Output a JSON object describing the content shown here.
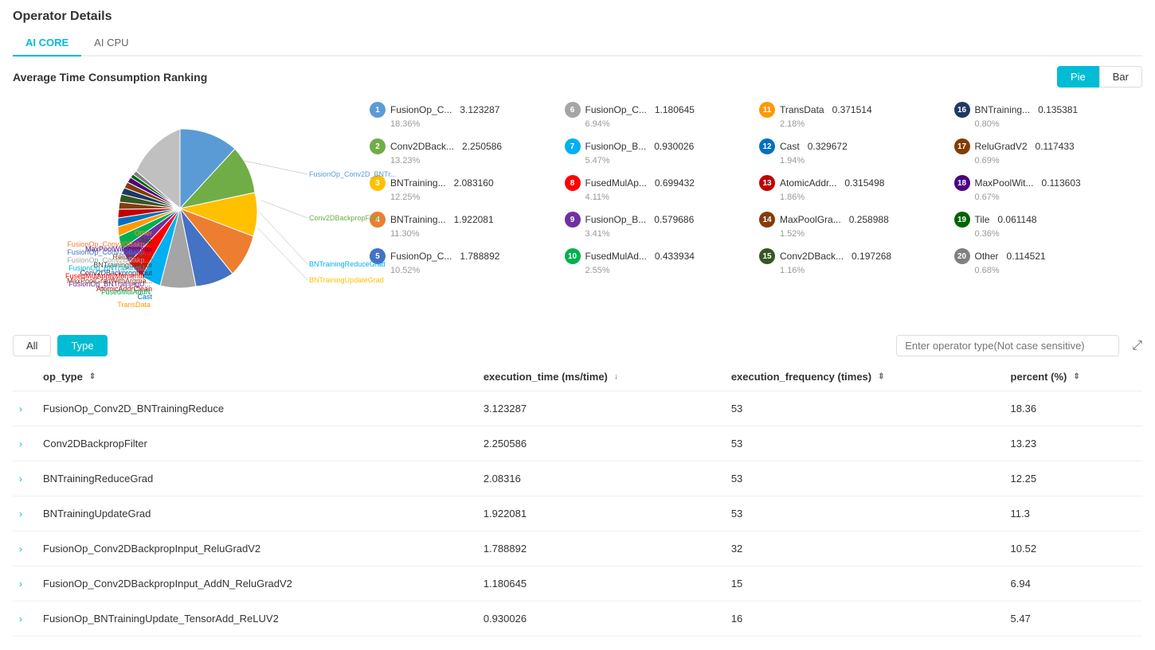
{
  "page": {
    "title": "Operator Details",
    "tabs": [
      {
        "label": "AI CORE",
        "active": true
      },
      {
        "label": "AI CPU",
        "active": false
      }
    ]
  },
  "section": {
    "title": "Average Time Consumption Ranking",
    "toggle_buttons": [
      {
        "label": "Pie",
        "active": true
      },
      {
        "label": "Bar",
        "active": false
      }
    ]
  },
  "pie_labels": [
    "Other",
    "Tile",
    "MaxPoolWithArgmax",
    "ReluGradV2",
    "BNTrainingUpdate",
    "Conv2DBackpropInput",
    "MaxPoolGradWithArgma...",
    "AtomicAddrClean",
    "Cast",
    "TransData",
    "FusedMulAddN",
    "FusionOp_BNTrainingU...",
    "FusedMulApplyMomentu...",
    "FusionOp_BNTrainingU...",
    "FusionOp_Conv2DBakp...",
    "FusionOp_Conv2DBakp...",
    "FusionOp_Conv2DBakp...",
    "BNTrainingReduceGrad",
    "BNTrainingUpdateGrad",
    "FusionOp_Conv2D_BNTr...",
    "Conv2DBackpropFilter"
  ],
  "legend": [
    {
      "num": 1,
      "name": "FusionOp_C...",
      "value": "3.123287",
      "pct": "18.36%",
      "color": "#5b9bd5"
    },
    {
      "num": 2,
      "name": "Conv2DBack...",
      "value": "2.250586",
      "pct": "13.23%",
      "color": "#70ad47"
    },
    {
      "num": 3,
      "name": "BNTraining...",
      "value": "2.083160",
      "pct": "12.25%",
      "color": "#ffc000"
    },
    {
      "num": 4,
      "name": "BNTraining...",
      "value": "1.922081",
      "pct": "11.30%",
      "color": "#ed7d31"
    },
    {
      "num": 5,
      "name": "FusionOp_C...",
      "value": "1.788892",
      "pct": "10.52%",
      "color": "#4472c4"
    },
    {
      "num": 6,
      "name": "FusionOp_C...",
      "value": "1.180645",
      "pct": "6.94%",
      "color": "#a5a5a5"
    },
    {
      "num": 7,
      "name": "FusionOp_B...",
      "value": "0.930026",
      "pct": "5.47%",
      "color": "#00b0f0"
    },
    {
      "num": 8,
      "name": "FusedMulAp...",
      "value": "0.699432",
      "pct": "4.11%",
      "color": "#ff0000"
    },
    {
      "num": 9,
      "name": "FusionOp_B...",
      "value": "0.579686",
      "pct": "3.41%",
      "color": "#7030a0"
    },
    {
      "num": 10,
      "name": "FusedMulAd...",
      "value": "0.433934",
      "pct": "2.55%",
      "color": "#00b050"
    },
    {
      "num": 11,
      "name": "TransData",
      "value": "0.371514",
      "pct": "2.18%",
      "color": "#ff9900"
    },
    {
      "num": 12,
      "name": "Cast",
      "value": "0.329672",
      "pct": "1.94%",
      "color": "#0070c0"
    },
    {
      "num": 13,
      "name": "AtomicAddr...",
      "value": "0.315498",
      "pct": "1.86%",
      "color": "#c00000"
    },
    {
      "num": 14,
      "name": "MaxPoolGra...",
      "value": "0.258988",
      "pct": "1.52%",
      "color": "#843c0c"
    },
    {
      "num": 15,
      "name": "Conv2DBack...",
      "value": "0.197268",
      "pct": "1.16%",
      "color": "#375623"
    },
    {
      "num": 16,
      "name": "BNTraining...",
      "value": "0.135381",
      "pct": "0.80%",
      "color": "#1f3864"
    },
    {
      "num": 17,
      "name": "ReluGradV2",
      "value": "0.117433",
      "pct": "0.69%",
      "color": "#833c00"
    },
    {
      "num": 18,
      "name": "MaxPoolWit...",
      "value": "0.113603",
      "pct": "0.67%",
      "color": "#4b0082"
    },
    {
      "num": 19,
      "name": "Tile",
      "value": "0.061148",
      "pct": "0.36%",
      "color": "#006400"
    },
    {
      "num": 20,
      "name": "Other",
      "value": "0.114521",
      "pct": "0.68%",
      "color": "#808080"
    }
  ],
  "filter": {
    "buttons": [
      "All",
      "Type"
    ],
    "active": "Type",
    "search_placeholder": "Enter operator type(Not case sensitive)"
  },
  "table": {
    "columns": [
      "",
      "op_type",
      "execution_time (ms/time)",
      "execution_frequency (times)",
      "percent (%)"
    ],
    "rows": [
      {
        "op_type": "FusionOp_Conv2D_BNTrainingReduce",
        "exec_time": "3.123287",
        "exec_freq": "53",
        "pct": "18.36"
      },
      {
        "op_type": "Conv2DBackpropFilter",
        "exec_time": "2.250586",
        "exec_freq": "53",
        "pct": "13.23"
      },
      {
        "op_type": "BNTrainingReduceGrad",
        "exec_time": "2.08316",
        "exec_freq": "53",
        "pct": "12.25"
      },
      {
        "op_type": "BNTrainingUpdateGrad",
        "exec_time": "1.922081",
        "exec_freq": "53",
        "pct": "11.3"
      },
      {
        "op_type": "FusionOp_Conv2DBackpropInput_ReluGradV2",
        "exec_time": "1.788892",
        "exec_freq": "32",
        "pct": "10.52"
      },
      {
        "op_type": "FusionOp_Conv2DBackpropInput_AddN_ReluGradV2",
        "exec_time": "1.180645",
        "exec_freq": "15",
        "pct": "6.94"
      },
      {
        "op_type": "FusionOp_BNTrainingUpdate_TensorAdd_ReLUV2",
        "exec_time": "0.930026",
        "exec_freq": "16",
        "pct": "5.47"
      }
    ]
  }
}
